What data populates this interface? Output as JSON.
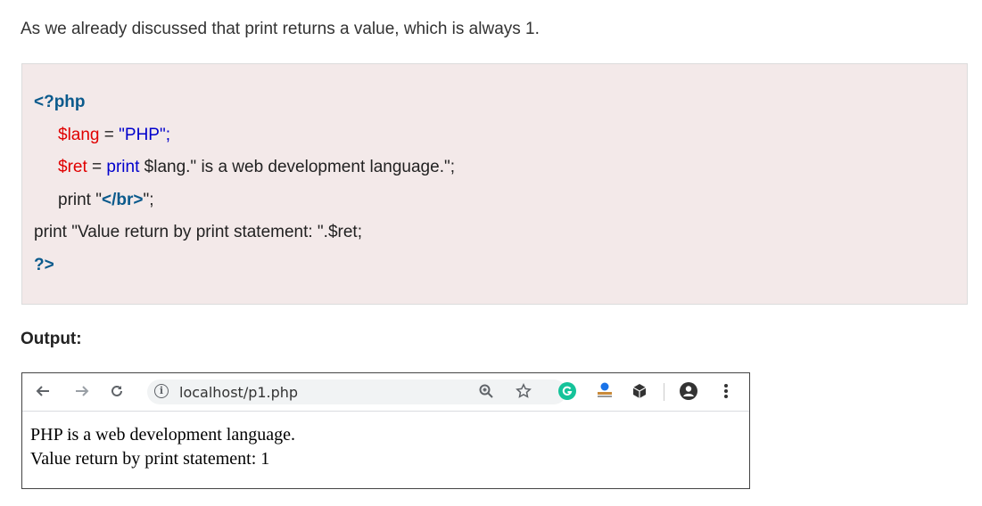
{
  "intro": "As we already discussed that print returns a value, which is always 1.",
  "code": {
    "open_tag": "<?php",
    "line1": {
      "var": "$lang",
      "op": " = ",
      "str": "\"PHP\";"
    },
    "line2": {
      "var": "$ret",
      "op": " = ",
      "fn": "print",
      "rest": " $lang.\" is a web development language.\";"
    },
    "line3": {
      "pre": "print \"",
      "tag": "</br>",
      "post": "\";"
    },
    "line4": "print \"Value return by print statement: \".$ret;",
    "close_tag": "?>"
  },
  "output_label": "Output:",
  "browser": {
    "url": "localhost/p1.php",
    "icons": [
      "back-arrow-icon",
      "forward-arrow-icon",
      "reload-icon",
      "info-icon",
      "zoom-icon",
      "star-icon",
      "grammarly-icon",
      "extension-icon",
      "cube-icon",
      "account-icon",
      "menu-icon"
    ],
    "accent_green": "#15c39a",
    "page_lines": [
      "PHP is a web development language.",
      "Value return by print statement: 1"
    ]
  }
}
